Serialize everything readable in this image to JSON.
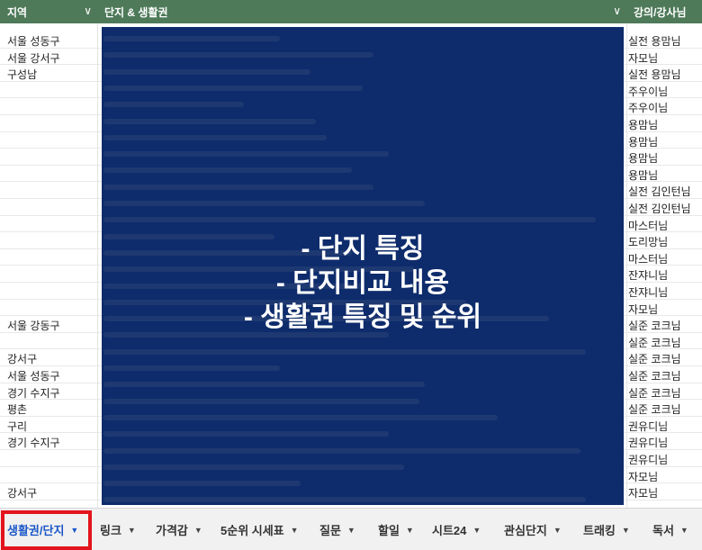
{
  "header": {
    "region_label": "지역",
    "complex_label": "단지 & 생활권",
    "lecturer_label": "강의/강사님"
  },
  "rows": [
    {
      "region": "서울 성동구",
      "lecturer": "실전 용맘님"
    },
    {
      "region": "서울 강서구",
      "lecturer": "자모님"
    },
    {
      "region": "구성남",
      "lecturer": "실전 용맘님"
    },
    {
      "region": "",
      "lecturer": "주우이님"
    },
    {
      "region": "",
      "lecturer": "주우이님"
    },
    {
      "region": "",
      "lecturer": "용맘님"
    },
    {
      "region": "",
      "lecturer": "용맘님"
    },
    {
      "region": "",
      "lecturer": "용맘님"
    },
    {
      "region": "",
      "lecturer": "용맘님"
    },
    {
      "region": "",
      "lecturer": "실전 김인턴님"
    },
    {
      "region": "",
      "lecturer": "실전 김인턴님"
    },
    {
      "region": "",
      "lecturer": "마스터님"
    },
    {
      "region": "",
      "lecturer": "도리망님"
    },
    {
      "region": "",
      "lecturer": "마스터님"
    },
    {
      "region": "",
      "lecturer": "잔쟈니님"
    },
    {
      "region": "",
      "lecturer": "잔쟈니님"
    },
    {
      "region": "",
      "lecturer": "자모님"
    },
    {
      "region": "서울 강동구",
      "lecturer": "실준 코크님"
    },
    {
      "region": "",
      "lecturer": "실준 코크님"
    },
    {
      "region": "강서구",
      "lecturer": "실준 코크님"
    },
    {
      "region": "서울 성동구",
      "lecturer": "실준 코크님"
    },
    {
      "region": "경기 수지구",
      "lecturer": "실준 코크님"
    },
    {
      "region": "평촌",
      "lecturer": "실준 코크님"
    },
    {
      "region": "구리",
      "lecturer": "권유디님"
    },
    {
      "region": "경기 수지구",
      "lecturer": "권유디님"
    },
    {
      "region": "",
      "lecturer": "권유디님"
    },
    {
      "region": "",
      "lecturer": "자모님"
    },
    {
      "region": "강서구",
      "lecturer": "자모님"
    }
  ],
  "overlay": {
    "line1": "- 단지 특징",
    "line2": "- 단지비교 내용",
    "line3": "- 생활권 특징 및 순위"
  },
  "tabs": [
    {
      "label": "생활권/단지",
      "active": true
    },
    {
      "label": "링크"
    },
    {
      "label": "가격감"
    },
    {
      "label": "5순위 시세표"
    },
    {
      "label": "질문"
    },
    {
      "label": "할일"
    },
    {
      "label": "시트24"
    },
    {
      "label": "관심단지"
    },
    {
      "label": "트래킹"
    },
    {
      "label": "독서"
    }
  ],
  "colors": {
    "header_bg": "#4f7a5a",
    "overlay_bg": "#0e2c6b",
    "active_tab_text": "#1a56c8",
    "highlight_border": "#e3141b"
  }
}
